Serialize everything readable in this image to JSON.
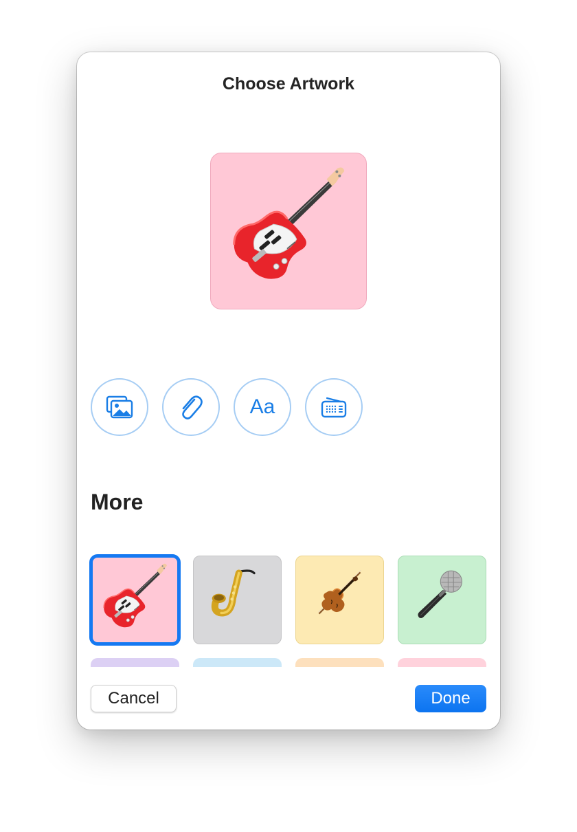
{
  "dialog": {
    "title": "Choose Artwork"
  },
  "preview": {
    "icon": "electric-guitar-emoji",
    "background": "#ffc8d6"
  },
  "sources": [
    {
      "name": "photos",
      "icon": "photo-stack-icon"
    },
    {
      "name": "attachment",
      "icon": "paperclip-icon"
    },
    {
      "name": "text",
      "icon": "text-format-icon",
      "label": "Aa"
    },
    {
      "name": "radio",
      "icon": "radio-icon"
    }
  ],
  "more": {
    "heading": "More",
    "tiles": [
      {
        "icon": "electric-guitar-emoji",
        "background": "#ffc8d6",
        "selected": true
      },
      {
        "icon": "saxophone-emoji",
        "background": "#d8d8da",
        "selected": false
      },
      {
        "icon": "violin-emoji",
        "background": "#fdeab3",
        "selected": false
      },
      {
        "icon": "microphone-emoji",
        "background": "#c8f0d0",
        "selected": false
      },
      {
        "icon": "unknown",
        "background": "#dcd0f4",
        "selected": false
      },
      {
        "icon": "unknown",
        "background": "#cce8f8",
        "selected": false
      },
      {
        "icon": "unknown",
        "background": "#fde0bd",
        "selected": false
      },
      {
        "icon": "unknown",
        "background": "#ffd2dc",
        "selected": false
      }
    ]
  },
  "footer": {
    "cancel_label": "Cancel",
    "done_label": "Done"
  },
  "colors": {
    "accent": "#1579f2",
    "source_button_border": "#a6cdf4",
    "source_icon": "#1a7ee6"
  }
}
